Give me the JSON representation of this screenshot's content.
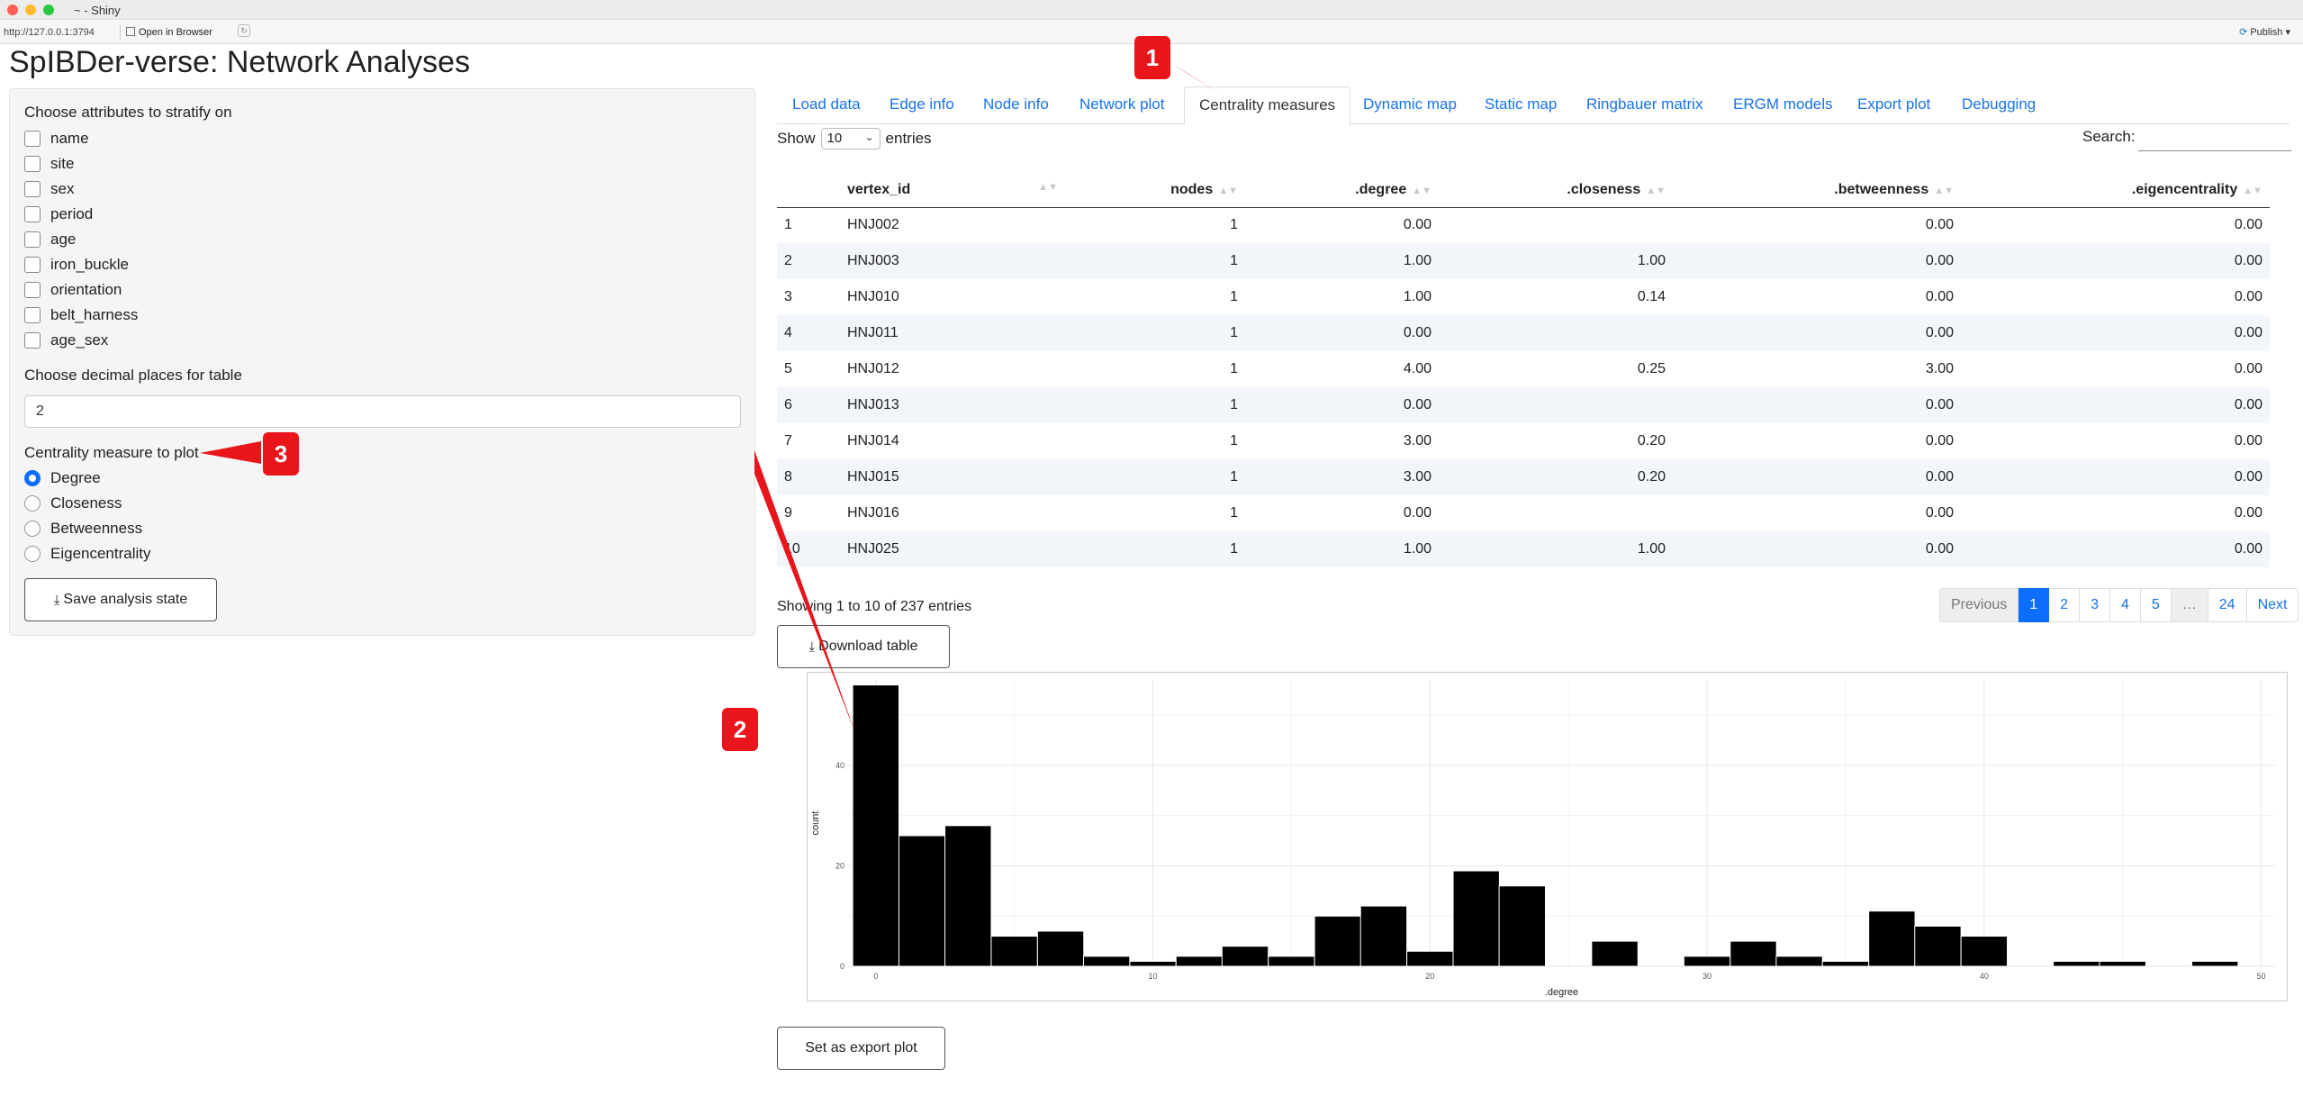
{
  "window": {
    "title": "~ - Shiny"
  },
  "toolbar": {
    "url": "http://127.0.0.1:3794",
    "open_browser": "Open in Browser",
    "publish": "Publish"
  },
  "app": {
    "title": "SpIBDer-verse: Network Analyses"
  },
  "sidebar": {
    "stratify_label": "Choose attributes to stratify on",
    "attributes": [
      "name",
      "site",
      "sex",
      "period",
      "age",
      "iron_buckle",
      "orientation",
      "belt_harness",
      "age_sex"
    ],
    "decimal_label": "Choose decimal places for table",
    "decimal_value": "2",
    "centrality_label": "Centrality measure to plot",
    "centrality_options": [
      "Degree",
      "Closeness",
      "Betweenness",
      "Eigencentrality"
    ],
    "centrality_selected": "Degree",
    "save_button": "Save analysis state"
  },
  "tabs": [
    "Load data",
    "Edge info",
    "Node info",
    "Network plot",
    "Centrality measures",
    "Dynamic map",
    "Static map",
    "Ringbauer matrix",
    "ERGM models",
    "Export plot",
    "Debugging"
  ],
  "active_tab": "Centrality measures",
  "table": {
    "show_label": "Show",
    "entries_value": "10",
    "entries_label": "entries",
    "search_label": "Search:",
    "columns": [
      "",
      "vertex_id",
      "nodes",
      ".degree",
      ".closeness",
      ".betweenness",
      ".eigencentrality"
    ],
    "rows": [
      [
        "1",
        "HNJ002",
        "1",
        "0.00",
        "",
        "0.00",
        "0.00"
      ],
      [
        "2",
        "HNJ003",
        "1",
        "1.00",
        "1.00",
        "0.00",
        "0.00"
      ],
      [
        "3",
        "HNJ010",
        "1",
        "1.00",
        "0.14",
        "0.00",
        "0.00"
      ],
      [
        "4",
        "HNJ011",
        "1",
        "0.00",
        "",
        "0.00",
        "0.00"
      ],
      [
        "5",
        "HNJ012",
        "1",
        "4.00",
        "0.25",
        "3.00",
        "0.00"
      ],
      [
        "6",
        "HNJ013",
        "1",
        "0.00",
        "",
        "0.00",
        "0.00"
      ],
      [
        "7",
        "HNJ014",
        "1",
        "3.00",
        "0.20",
        "0.00",
        "0.00"
      ],
      [
        "8",
        "HNJ015",
        "1",
        "3.00",
        "0.20",
        "0.00",
        "0.00"
      ],
      [
        "9",
        "HNJ016",
        "1",
        "0.00",
        "",
        "0.00",
        "0.00"
      ],
      [
        "10",
        "HNJ025",
        "1",
        "1.00",
        "1.00",
        "0.00",
        "0.00"
      ]
    ],
    "info": "Showing 1 to 10 of 237 entries",
    "pagination": [
      "Previous",
      "1",
      "2",
      "3",
      "4",
      "5",
      "…",
      "24",
      "Next"
    ],
    "current_page": "1",
    "download_button": "Download table"
  },
  "export_button": "Set as export plot",
  "annotations": [
    "1",
    "2",
    "3"
  ],
  "colors": {
    "accent": "#0d6efd",
    "link": "#1a73e8",
    "callout": "#e8151b"
  },
  "chart_data": {
    "type": "bar",
    "xlabel": ".degree",
    "ylabel": "count",
    "x_ticks": [
      0,
      10,
      20,
      30,
      40,
      50
    ],
    "y_ticks": [
      0,
      20,
      40
    ],
    "xlim": [
      -1,
      50.5
    ],
    "ylim": [
      0,
      57
    ],
    "bin_width": 1.67,
    "bins": [
      {
        "x": 0,
        "count": 56
      },
      {
        "x": 1.67,
        "count": 26
      },
      {
        "x": 3.33,
        "count": 28
      },
      {
        "x": 5,
        "count": 6
      },
      {
        "x": 6.67,
        "count": 7
      },
      {
        "x": 8.33,
        "count": 2
      },
      {
        "x": 10,
        "count": 1
      },
      {
        "x": 11.67,
        "count": 2
      },
      {
        "x": 13.33,
        "count": 4
      },
      {
        "x": 15,
        "count": 2
      },
      {
        "x": 16.67,
        "count": 10
      },
      {
        "x": 18.33,
        "count": 12
      },
      {
        "x": 20,
        "count": 3
      },
      {
        "x": 21.67,
        "count": 19
      },
      {
        "x": 23.33,
        "count": 16
      },
      {
        "x": 26.67,
        "count": 5
      },
      {
        "x": 30,
        "count": 2
      },
      {
        "x": 31.67,
        "count": 5
      },
      {
        "x": 33.33,
        "count": 2
      },
      {
        "x": 35,
        "count": 1
      },
      {
        "x": 36.67,
        "count": 11
      },
      {
        "x": 38.33,
        "count": 8
      },
      {
        "x": 40,
        "count": 6
      },
      {
        "x": 43.33,
        "count": 1
      },
      {
        "x": 45,
        "count": 1
      },
      {
        "x": 48.33,
        "count": 1
      }
    ],
    "grid": true
  }
}
